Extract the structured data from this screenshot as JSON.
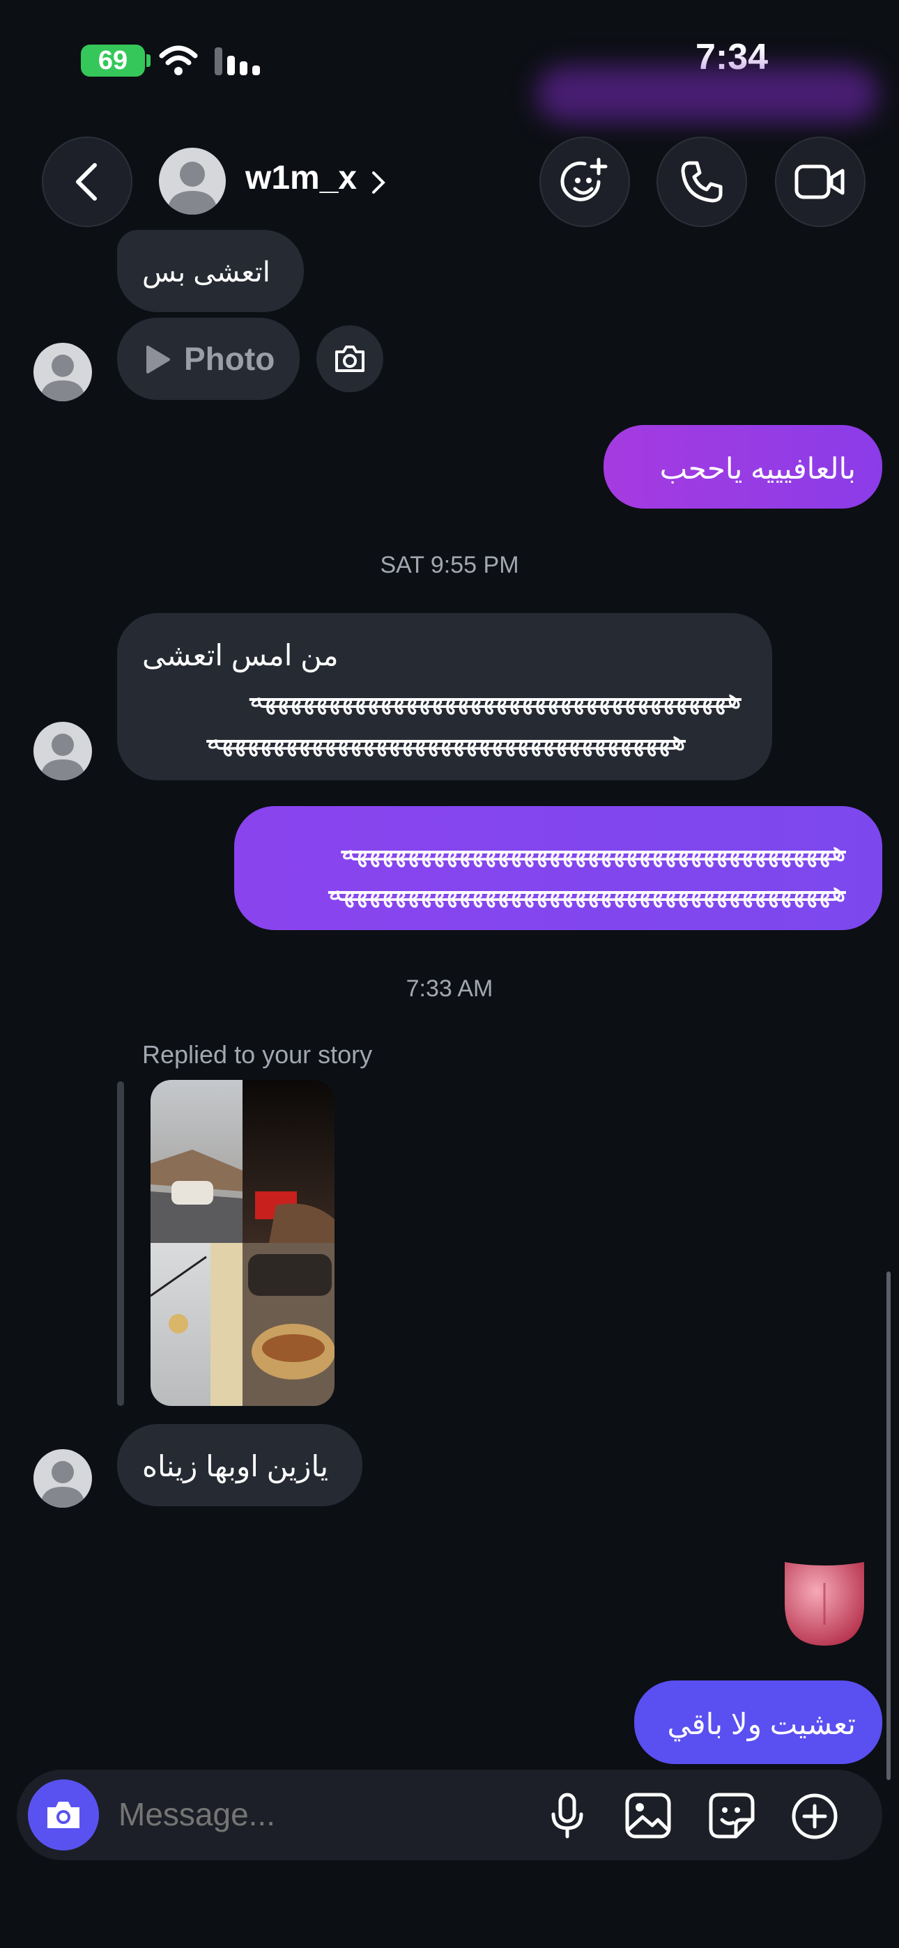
{
  "status_bar": {
    "time": "7:34",
    "battery": "69"
  },
  "header": {
    "username": "w1m_x"
  },
  "messages": {
    "m1_text": "اتعشى بس",
    "m2_label": "Photo",
    "m3_text": "بالعافيييه ياححب",
    "sep1": "SAT 9:55 PM",
    "m4_line1": "من امس اتعشى",
    "m4_line2": "هههههههههههههههههههههههههههههههههههههه",
    "m4_line3": "ههههههههههههههههههههههههههههههههههههه",
    "m5_line1": "ههههههههههههههههههههههههههههههههههههههه",
    "m5_line2": "هههههههههههههههههههههههههههههههههههههههه",
    "sep2": "7:33 AM",
    "story_caption": "Replied to your story",
    "m6_text": "يازين اوبها زيناه",
    "m7_text": "تعشيت ولا باقي"
  },
  "composer": {
    "placeholder": "Message..."
  },
  "colors": {
    "outgoing_1": "#a53be0",
    "outgoing_2": "#8a44ee",
    "outgoing_3": "#5a4ff0",
    "incoming": "#262a33",
    "background": "#0c0f14"
  }
}
